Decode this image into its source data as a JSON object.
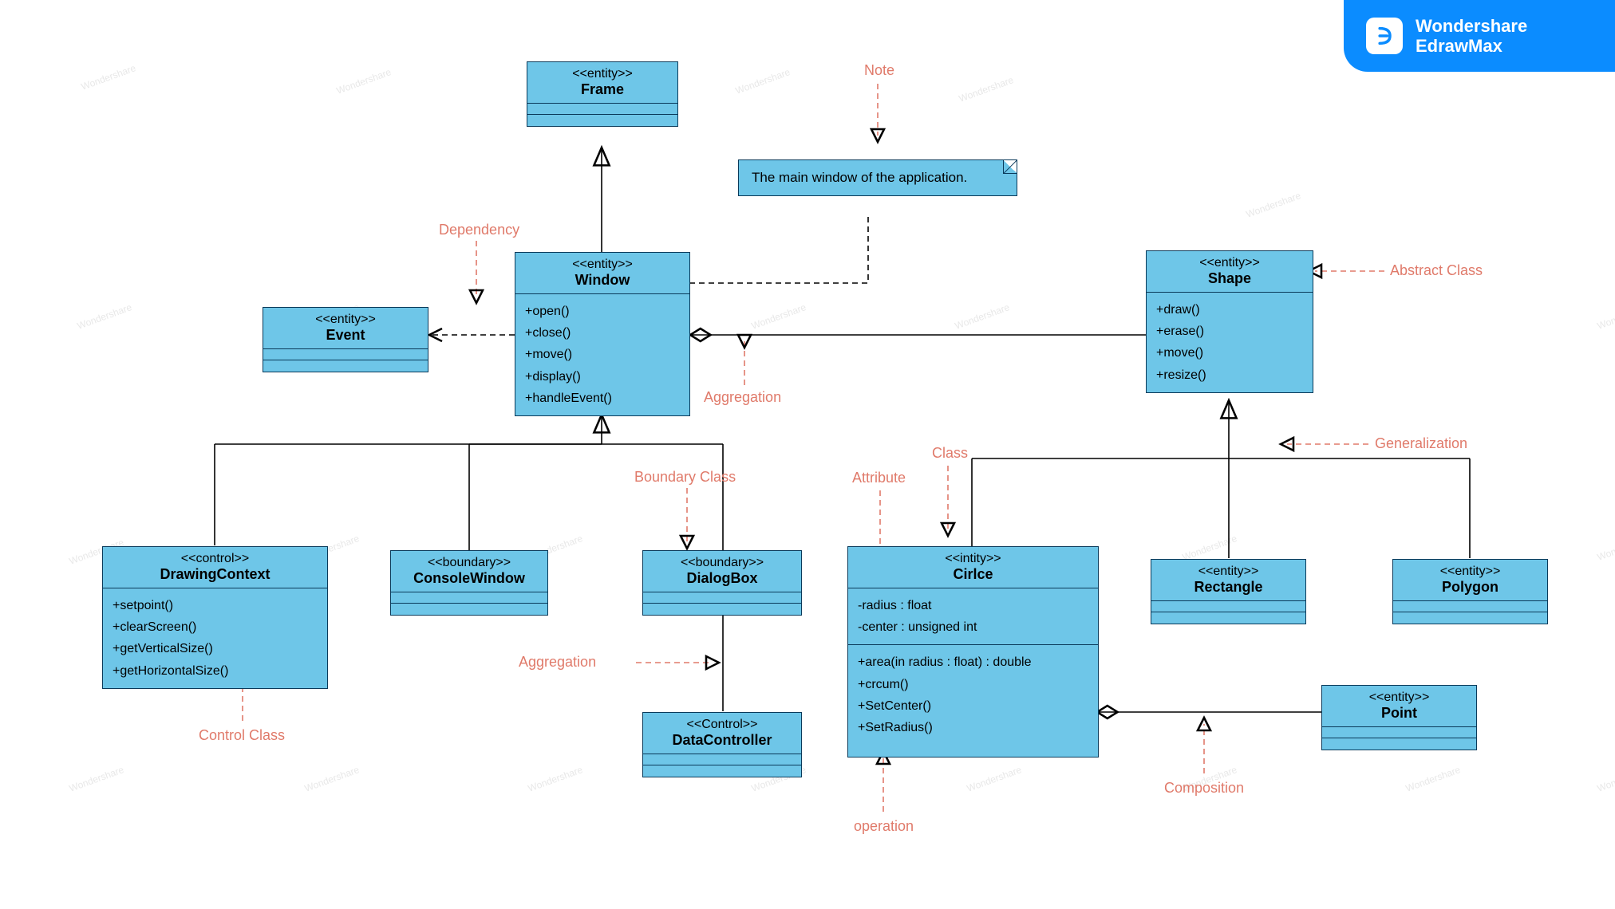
{
  "brand": {
    "line1": "Wondershare",
    "line2": "EdrawMax",
    "icon_glyph": "⊃"
  },
  "classes": {
    "frame": {
      "stereo": "<<entity>>",
      "name": "Frame"
    },
    "window": {
      "stereo": "<<entity>>",
      "name": "Window",
      "ops": [
        "+open()",
        "+close()",
        "+move()",
        "+display()",
        "+handleEvent()"
      ]
    },
    "event": {
      "stereo": "<<entity>>",
      "name": "Event"
    },
    "shape": {
      "stereo": "<<entity>>",
      "name": "Shape",
      "ops": [
        "+draw()",
        "+erase()",
        "+move()",
        "+resize()"
      ]
    },
    "drawingcontext": {
      "stereo": "<<control>>",
      "name": "DrawingContext",
      "ops": [
        "+setpoint()",
        "+clearScreen()",
        "+getVerticalSize()",
        "+getHorizontalSize()"
      ]
    },
    "consolewindow": {
      "stereo": "<<boundary>>",
      "name": "ConsoleWindow"
    },
    "dialogbox": {
      "stereo": "<<boundary>>",
      "name": "DialogBox"
    },
    "circle": {
      "stereo": "<<intity>>",
      "name": "Cirlce",
      "attrs": [
        "-radius : float",
        "-center : unsigned int"
      ],
      "ops": [
        "+area(in radius : float) : double",
        "+crcum()",
        "+SetCenter()",
        "+SetRadius()"
      ]
    },
    "rectangle": {
      "stereo": "<<entity>>",
      "name": "Rectangle"
    },
    "polygon": {
      "stereo": "<<entity>>",
      "name": "Polygon"
    },
    "point": {
      "stereo": "<<entity>>",
      "name": "Point"
    },
    "datacontroller": {
      "stereo": "<<Control>>",
      "name": "DataController"
    }
  },
  "note_text": "The main window of the application.",
  "labels": {
    "note": "Note",
    "dependency": "Dependency",
    "aggregation1": "Aggregation",
    "aggregation2": "Aggregation",
    "abstract": "Abstract Class",
    "generalization": "Generalization",
    "boundary": "Boundary Class",
    "class": "Class",
    "attribute": "Attribute",
    "control": "Control Class",
    "operation": "operation",
    "composition": "Composition"
  }
}
